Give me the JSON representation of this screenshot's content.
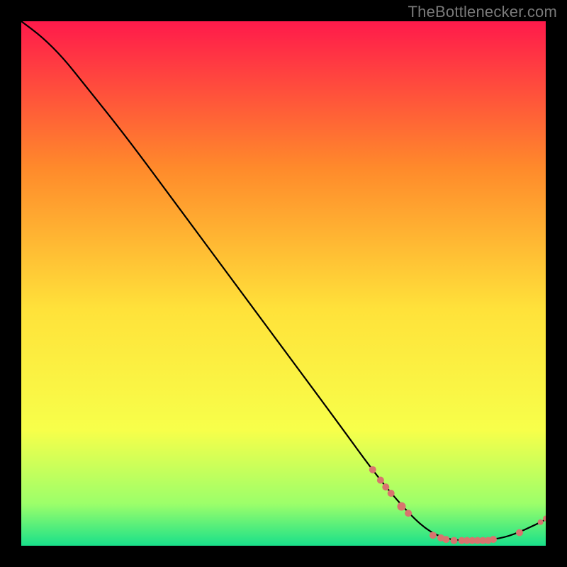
{
  "attribution": "TheBottlenecker.com",
  "chart_data": {
    "type": "line",
    "title": "",
    "xlabel": "",
    "ylabel": "",
    "xlim": [
      0,
      100
    ],
    "ylim": [
      0,
      100
    ],
    "background_gradient": {
      "top": "#ff1a4b",
      "mid_upper": "#ff8a2b",
      "mid": "#ffe23a",
      "mid_lower": "#f7ff4a",
      "low": "#9cff6a",
      "bottom": "#19e08a"
    },
    "curve": [
      {
        "x": 0,
        "y": 100
      },
      {
        "x": 4,
        "y": 97
      },
      {
        "x": 8,
        "y": 93
      },
      {
        "x": 12,
        "y": 88
      },
      {
        "x": 20,
        "y": 78
      },
      {
        "x": 30,
        "y": 64.5
      },
      {
        "x": 40,
        "y": 51
      },
      {
        "x": 50,
        "y": 37.5
      },
      {
        "x": 60,
        "y": 24
      },
      {
        "x": 68,
        "y": 13
      },
      {
        "x": 74,
        "y": 6
      },
      {
        "x": 78,
        "y": 2.5
      },
      {
        "x": 82,
        "y": 1
      },
      {
        "x": 88,
        "y": 1
      },
      {
        "x": 92,
        "y": 1.5
      },
      {
        "x": 96,
        "y": 3
      },
      {
        "x": 100,
        "y": 5
      }
    ],
    "markers": [
      {
        "x": 67.0,
        "y": 14.5,
        "r": 5
      },
      {
        "x": 68.5,
        "y": 12.5,
        "r": 5
      },
      {
        "x": 69.5,
        "y": 11.2,
        "r": 5
      },
      {
        "x": 70.5,
        "y": 10.0,
        "r": 5
      },
      {
        "x": 72.5,
        "y": 7.5,
        "r": 6
      },
      {
        "x": 73.8,
        "y": 6.2,
        "r": 5
      },
      {
        "x": 78.5,
        "y": 2.0,
        "r": 5
      },
      {
        "x": 80.0,
        "y": 1.5,
        "r": 5
      },
      {
        "x": 81.0,
        "y": 1.2,
        "r": 5
      },
      {
        "x": 82.5,
        "y": 1.0,
        "r": 5
      },
      {
        "x": 84.0,
        "y": 1.0,
        "r": 5
      },
      {
        "x": 85.0,
        "y": 1.0,
        "r": 5
      },
      {
        "x": 86.0,
        "y": 1.0,
        "r": 5
      },
      {
        "x": 87.0,
        "y": 1.0,
        "r": 5
      },
      {
        "x": 88.0,
        "y": 1.0,
        "r": 5
      },
      {
        "x": 89.0,
        "y": 1.0,
        "r": 5
      },
      {
        "x": 90.0,
        "y": 1.2,
        "r": 5
      },
      {
        "x": 95.0,
        "y": 2.5,
        "r": 5
      },
      {
        "x": 99.0,
        "y": 4.5,
        "r": 4
      },
      {
        "x": 100.0,
        "y": 5.2,
        "r": 4
      }
    ],
    "marker_color": "#d8746e",
    "curve_color": "#000000"
  }
}
